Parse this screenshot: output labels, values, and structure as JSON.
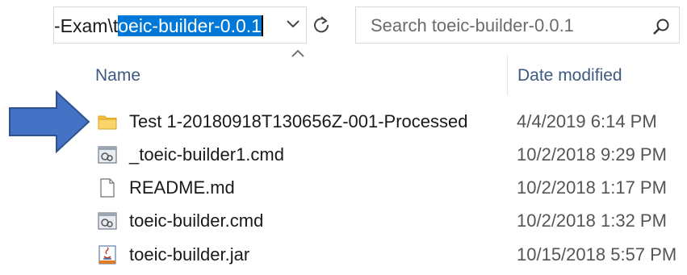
{
  "address_bar": {
    "path_prefix": "-Exam\\t",
    "path_selected": "oeic-builder-0.0.1"
  },
  "search": {
    "placeholder": "Search toeic-builder-0.0.1"
  },
  "columns": {
    "name": "Name",
    "date_modified": "Date modified"
  },
  "files": [
    {
      "name": "Test 1-20180918T130656Z-001-Processed",
      "date": "4/4/2019 6:14 PM",
      "icon": "folder-icon"
    },
    {
      "name": "_toeic-builder1.cmd",
      "date": "10/2/2018 9:29 PM",
      "icon": "cmd-file-icon"
    },
    {
      "name": "README.md",
      "date": "10/2/2018 1:17 PM",
      "icon": "text-file-icon"
    },
    {
      "name": "toeic-builder.cmd",
      "date": "10/2/2018 1:32 PM",
      "icon": "cmd-file-icon"
    },
    {
      "name": "toeic-builder.jar",
      "date": "10/15/2018 5:57 PM",
      "icon": "jar-file-icon"
    }
  ],
  "colors": {
    "selection": "#0078d7",
    "header_text": "#3d5a80",
    "folder": "#f5c242",
    "annotation_arrow": "#4472c4"
  }
}
